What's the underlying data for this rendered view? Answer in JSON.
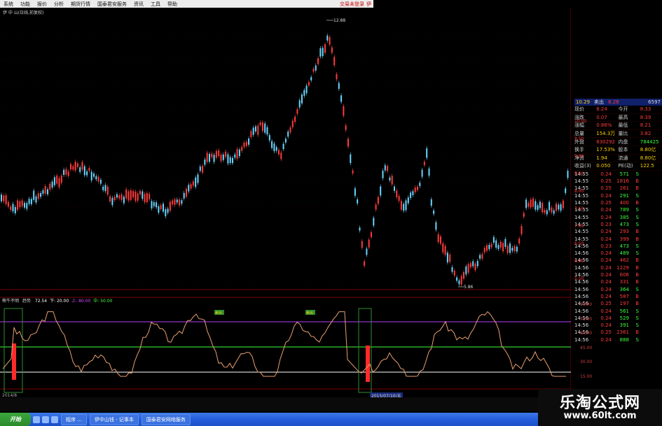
{
  "menu": {
    "items": [
      "系统",
      "功能",
      "报价",
      "分析",
      "期货行情",
      "国泰君安服务",
      "资讯",
      "工具",
      "帮助"
    ],
    "trade_label": "交易未登录",
    "right_icon": "伊"
  },
  "chart_title": "伊 中 山(日线,前复权)",
  "price_axis": [
    "10.29",
    "10.00",
    "9.50",
    "9.00",
    "8.50",
    "8.00",
    "7.50",
    "7.00",
    "6.50",
    "6.00",
    "5.50"
  ],
  "annotations": {
    "high": "12.88",
    "low": "5.86"
  },
  "indicator": {
    "name": "熊牛不明",
    "param_label": "趋势",
    "values": [
      {
        "text": "72.54",
        "color": "#ffffff"
      },
      {
        "text": "下: 20.00",
        "color": "#ffffff"
      },
      {
        "text": "上: 80.00",
        "color": "#d24bff"
      },
      {
        "text": "中: 50.00",
        "color": "#4bff4b"
      }
    ],
    "axis": [
      "90.00",
      "75.00",
      "60.00",
      "45.00",
      "30.00",
      "15.00"
    ],
    "tags": [
      "卖出",
      "卖出"
    ]
  },
  "dates": {
    "start": "2014/8",
    "highlight": "2015/07/10/五"
  },
  "quote": {
    "header": {
      "code": "10.29",
      "name": "卖出",
      "price": "8.28",
      "vol": "6597"
    },
    "rows": [
      {
        "l1": "现价",
        "v1": "8.24",
        "l2": "今开",
        "v2": "8.33",
        "c1": "red",
        "c2": "red"
      },
      {
        "l1": "涨跌",
        "v1": "0.07",
        "l2": "最高",
        "v2": "8.39",
        "c1": "red",
        "c2": "red"
      },
      {
        "l1": "涨幅",
        "v1": "0.86%",
        "l2": "最低",
        "v2": "8.21",
        "c1": "red",
        "c2": "red"
      },
      {
        "l1": "总量",
        "v1": "154.3万",
        "l2": "量比",
        "v2": "3.82",
        "c1": "yel",
        "c2": "red"
      },
      {
        "l1": "外盘",
        "v1": "830292",
        "l2": "内盘",
        "v2": "784425",
        "c1": "red",
        "c2": "grn"
      },
      {
        "l1": "换手",
        "v1": "17.53%",
        "l2": "股本",
        "v2": "8.80亿",
        "c1": "yel",
        "c2": "yel"
      },
      {
        "l1": "净资",
        "v1": "1.94",
        "l2": "流通",
        "v2": "8.80亿",
        "c1": "yel",
        "c2": "yel"
      },
      {
        "l1": "收益(3)",
        "v1": "0.050",
        "l2": "PE(动)",
        "v2": "122.5",
        "c1": "yel",
        "c2": "yel"
      }
    ],
    "trades": [
      {
        "t": "14:55",
        "p": "0.24",
        "v": "571",
        "b": "S"
      },
      {
        "t": "14:55",
        "p": "0.25",
        "v": "1816",
        "b": "B"
      },
      {
        "t": "14:55",
        "p": "0.25",
        "v": "261",
        "b": "B"
      },
      {
        "t": "14:55",
        "p": "0.24",
        "v": "291",
        "b": "S"
      },
      {
        "t": "14:55",
        "p": "0.25",
        "v": "400",
        "b": "B"
      },
      {
        "t": "14:55",
        "p": "0.24",
        "v": "789",
        "b": "S"
      },
      {
        "t": "14:55",
        "p": "0.24",
        "v": "385",
        "b": "S"
      },
      {
        "t": "14:55",
        "p": "0.23",
        "v": "473",
        "b": "S"
      },
      {
        "t": "14:55",
        "p": "0.24",
        "v": "293",
        "b": "B"
      },
      {
        "t": "14:55",
        "p": "0.24",
        "v": "399",
        "b": "B"
      },
      {
        "t": "14:56",
        "p": "0.23",
        "v": "473",
        "b": "S"
      },
      {
        "t": "14:56",
        "p": "0.24",
        "v": "489",
        "b": "S"
      },
      {
        "t": "14:56",
        "p": "0.24",
        "v": "462",
        "b": "B"
      },
      {
        "t": "14:56",
        "p": "0.24",
        "v": "1229",
        "b": "B"
      },
      {
        "t": "14:56",
        "p": "0.24",
        "v": "606",
        "b": "B"
      },
      {
        "t": "14:56",
        "p": "0.24",
        "v": "331",
        "b": "B"
      },
      {
        "t": "14:56",
        "p": "0.24",
        "v": "364",
        "b": "S"
      },
      {
        "t": "14:56",
        "p": "0.24",
        "v": "587",
        "b": "B"
      },
      {
        "t": "14:56",
        "p": "0.25",
        "v": "197",
        "b": "B"
      },
      {
        "t": "14:56",
        "p": "0.24",
        "v": "561",
        "b": "S"
      },
      {
        "t": "14:56",
        "p": "0.24",
        "v": "529",
        "b": "S"
      },
      {
        "t": "14:56",
        "p": "0.24",
        "v": "391",
        "b": "S"
      },
      {
        "t": "14:56",
        "p": "0.25",
        "v": "2361",
        "b": "B"
      },
      {
        "t": "14:56",
        "p": "0.24",
        "v": "888",
        "b": "S"
      }
    ]
  },
  "taskbar": {
    "start": "开始",
    "buttons": [
      "程序 ...",
      "伊中山钱 - 记事本",
      "国泰君安网络服务"
    ]
  },
  "watermark": {
    "line1": "乐淘公式网",
    "line2": "www.60lt.com"
  },
  "colors": {
    "up": "#ff3c3c",
    "down": "#6ad6ff",
    "line": "#e8a070",
    "upper": "#b040ff",
    "mid": "#40ff40",
    "lower": "#ffffff"
  }
}
